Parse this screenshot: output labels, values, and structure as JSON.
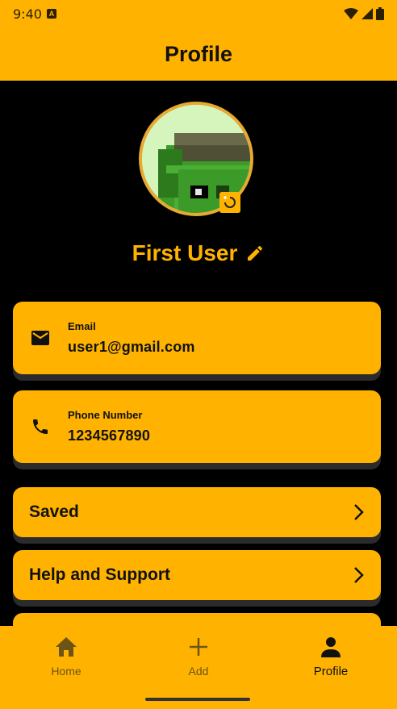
{
  "status_bar": {
    "time": "9:40",
    "badge": "A"
  },
  "app_bar": {
    "title": "Profile"
  },
  "profile": {
    "name": "First User"
  },
  "contact": {
    "email": {
      "label": "Email",
      "value": "user1@gmail.com",
      "icon": "mail-icon"
    },
    "phone": {
      "label": "Phone Number",
      "value": "1234567890",
      "icon": "phone-icon"
    }
  },
  "menu": {
    "saved": "Saved",
    "help": "Help and Support"
  },
  "nav": {
    "home": "Home",
    "add": "Add",
    "profile": "Profile",
    "active": "profile"
  },
  "colors": {
    "accent": "#FFB300",
    "background": "#000000",
    "text": "#111111"
  }
}
